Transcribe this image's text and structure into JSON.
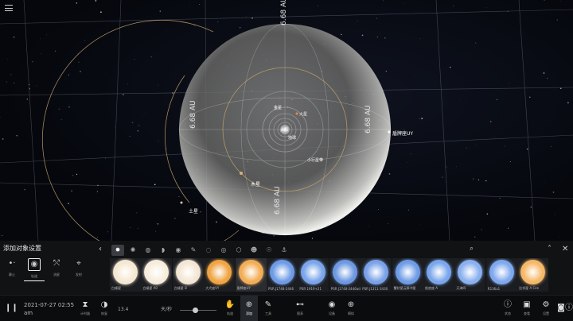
{
  "scene": {
    "au_label": "6.68 AU",
    "planets": {
      "saturn": "土星",
      "jupiter": "木星",
      "mars": "火星",
      "earth": "地球",
      "venus": "金星",
      "sun": "太阳",
      "belt": "小行星带",
      "star": "盾牌座UY"
    }
  },
  "panel": {
    "title": "添加对象设置",
    "modes": [
      {
        "label": "静止",
        "icon": "•·"
      },
      {
        "label": "轨道",
        "icon": "◉"
      },
      {
        "label": "流星",
        "icon": "⤲"
      },
      {
        "label": "发射",
        "icon": "⌖"
      }
    ],
    "tabs": [
      "✸",
      "✺",
      "◍",
      "◗",
      "◉",
      "✎",
      "◌",
      "◎",
      "⬡",
      "☻",
      "☉",
      "⚓"
    ],
    "cards": [
      {
        "label": "白矮星",
        "color": "#f5e8d2"
      },
      {
        "label": "白矮星 A0",
        "color": "#f7ecdc"
      },
      {
        "label": "白矮星 B",
        "color": "#f3e6d4"
      },
      {
        "label": "大犬座VY",
        "color": "#f0a443"
      },
      {
        "label": "盾牌座UY",
        "color": "#f2ad55"
      },
      {
        "label": "PSR J1748-2446",
        "color": "#6e9be6"
      },
      {
        "label": "PSR 1919+21",
        "color": "#7aa5ea"
      },
      {
        "label": "PSR J1748-2446ad",
        "color": "#6d98e2"
      },
      {
        "label": "PSR J1311-3430",
        "color": "#7aa2e8"
      },
      {
        "label": "蟹状星云脉冲星",
        "color": "#6f9ce6"
      },
      {
        "label": "船底座 A",
        "color": "#7aa6ec"
      },
      {
        "label": "天津四",
        "color": "#8ab0f0"
      },
      {
        "label": "R136a1",
        "color": "#7fa8ee"
      },
      {
        "label": "比邻星 A Cen",
        "color": "#f5b868"
      }
    ]
  },
  "bar": {
    "date": "2021-07-27 02:55",
    "ampm": "am",
    "speed_value": "13.4",
    "speed_unit": "天/秒",
    "items": [
      "计时器",
      "恢复",
      "轨道",
      "添加",
      "工具",
      "图表",
      "设备",
      "模拟",
      "状态",
      "查看",
      "设置"
    ]
  }
}
